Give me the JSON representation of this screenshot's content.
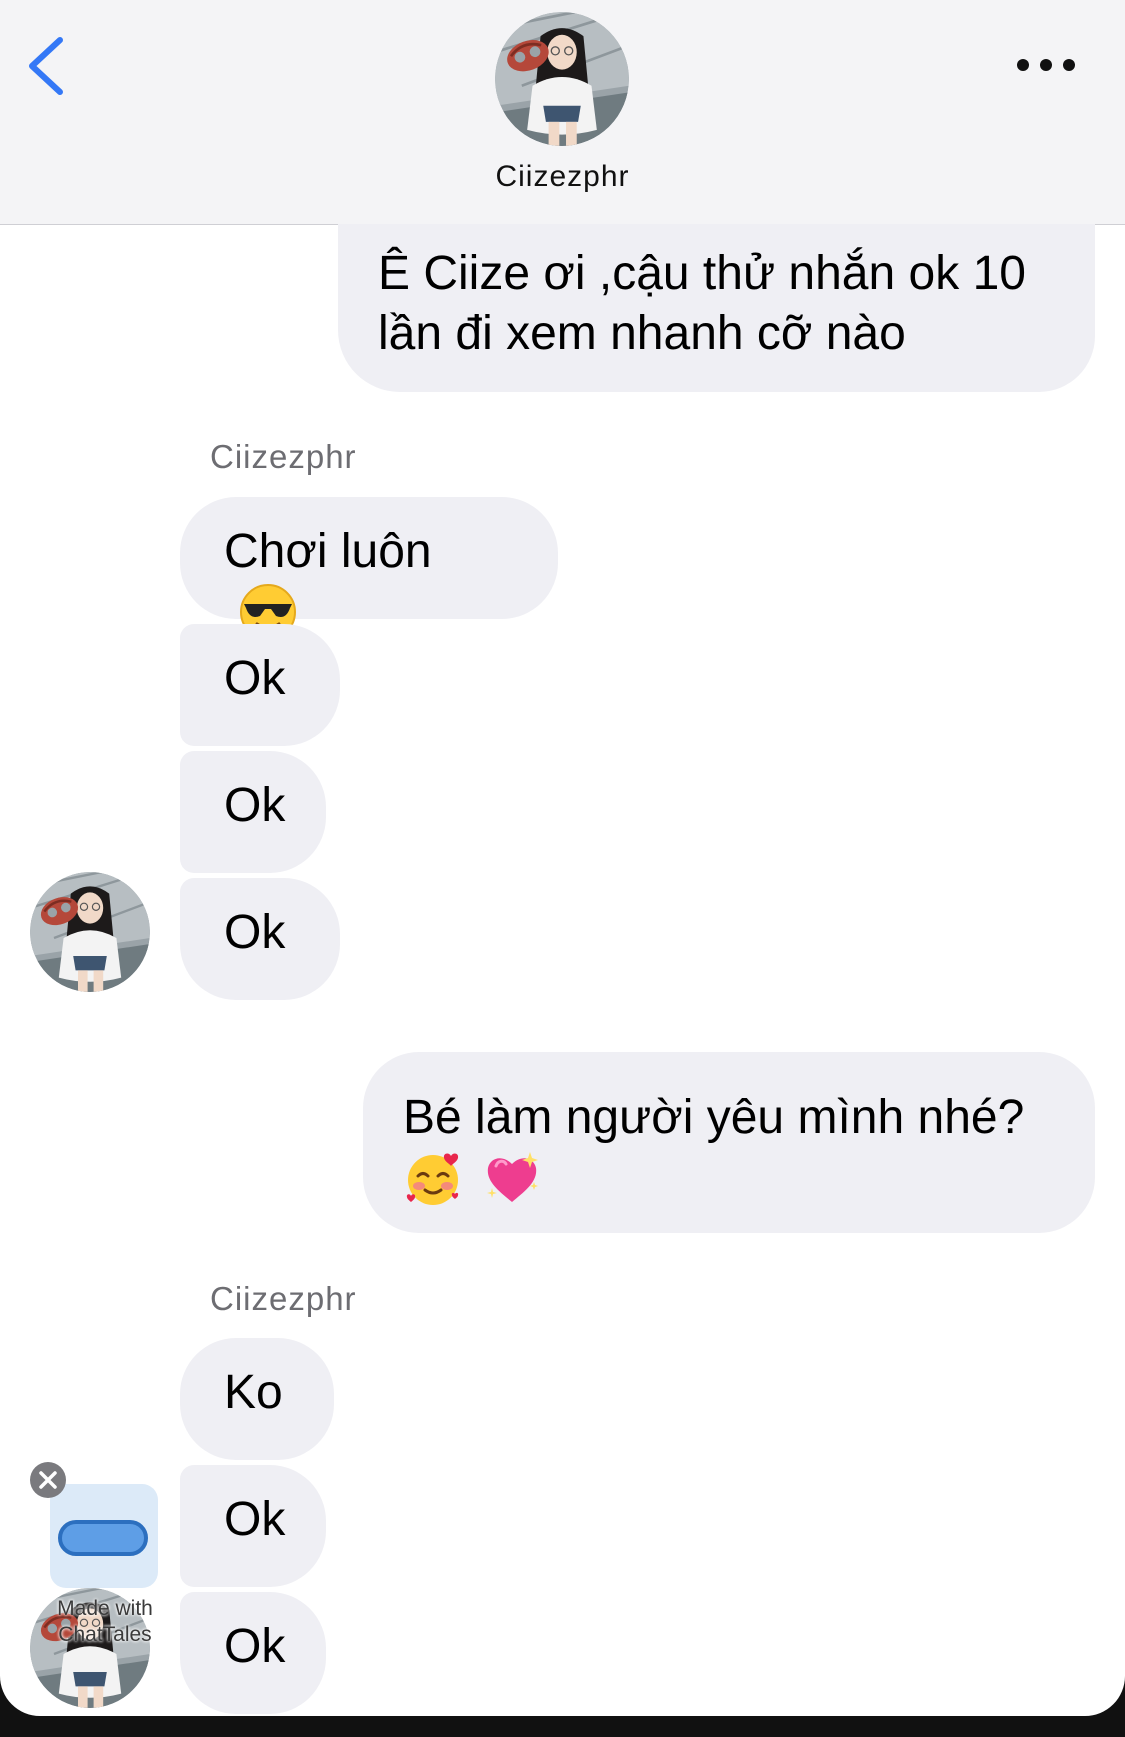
{
  "header": {
    "contact_name": "Ciizezphr",
    "back_icon": "chevron-left-icon",
    "more_icon": "ellipsis-icon",
    "accent_color": "#3478f6"
  },
  "messages": [
    {
      "from": "me",
      "text": "Ê Ciize ơi ,cậu thử nhắn ok 10 lần đi xem nhanh cỡ nào"
    },
    {
      "from": "them",
      "sender_label": "Ciizezphr",
      "text": "Chơi luôn",
      "emoji": "sunglasses-emoji"
    },
    {
      "from": "them",
      "text": "Ok"
    },
    {
      "from": "them",
      "text": "Ok"
    },
    {
      "from": "them",
      "text": "Ok"
    },
    {
      "from": "me",
      "text": "Bé làm người yêu mình nhé?",
      "emoji": [
        "smiling-face-with-hearts-emoji",
        "sparkling-heart-emoji"
      ]
    },
    {
      "from": "them",
      "sender_label": "Ciizezphr",
      "text": "Ko"
    },
    {
      "from": "them",
      "text": "Ok"
    },
    {
      "from": "them",
      "text": "Ok"
    }
  ],
  "watermark": {
    "text_line1": "Made with",
    "text_line2": "ChatTales",
    "close_icon": "close-icon",
    "app_icon": "chat-bubble-icon"
  }
}
